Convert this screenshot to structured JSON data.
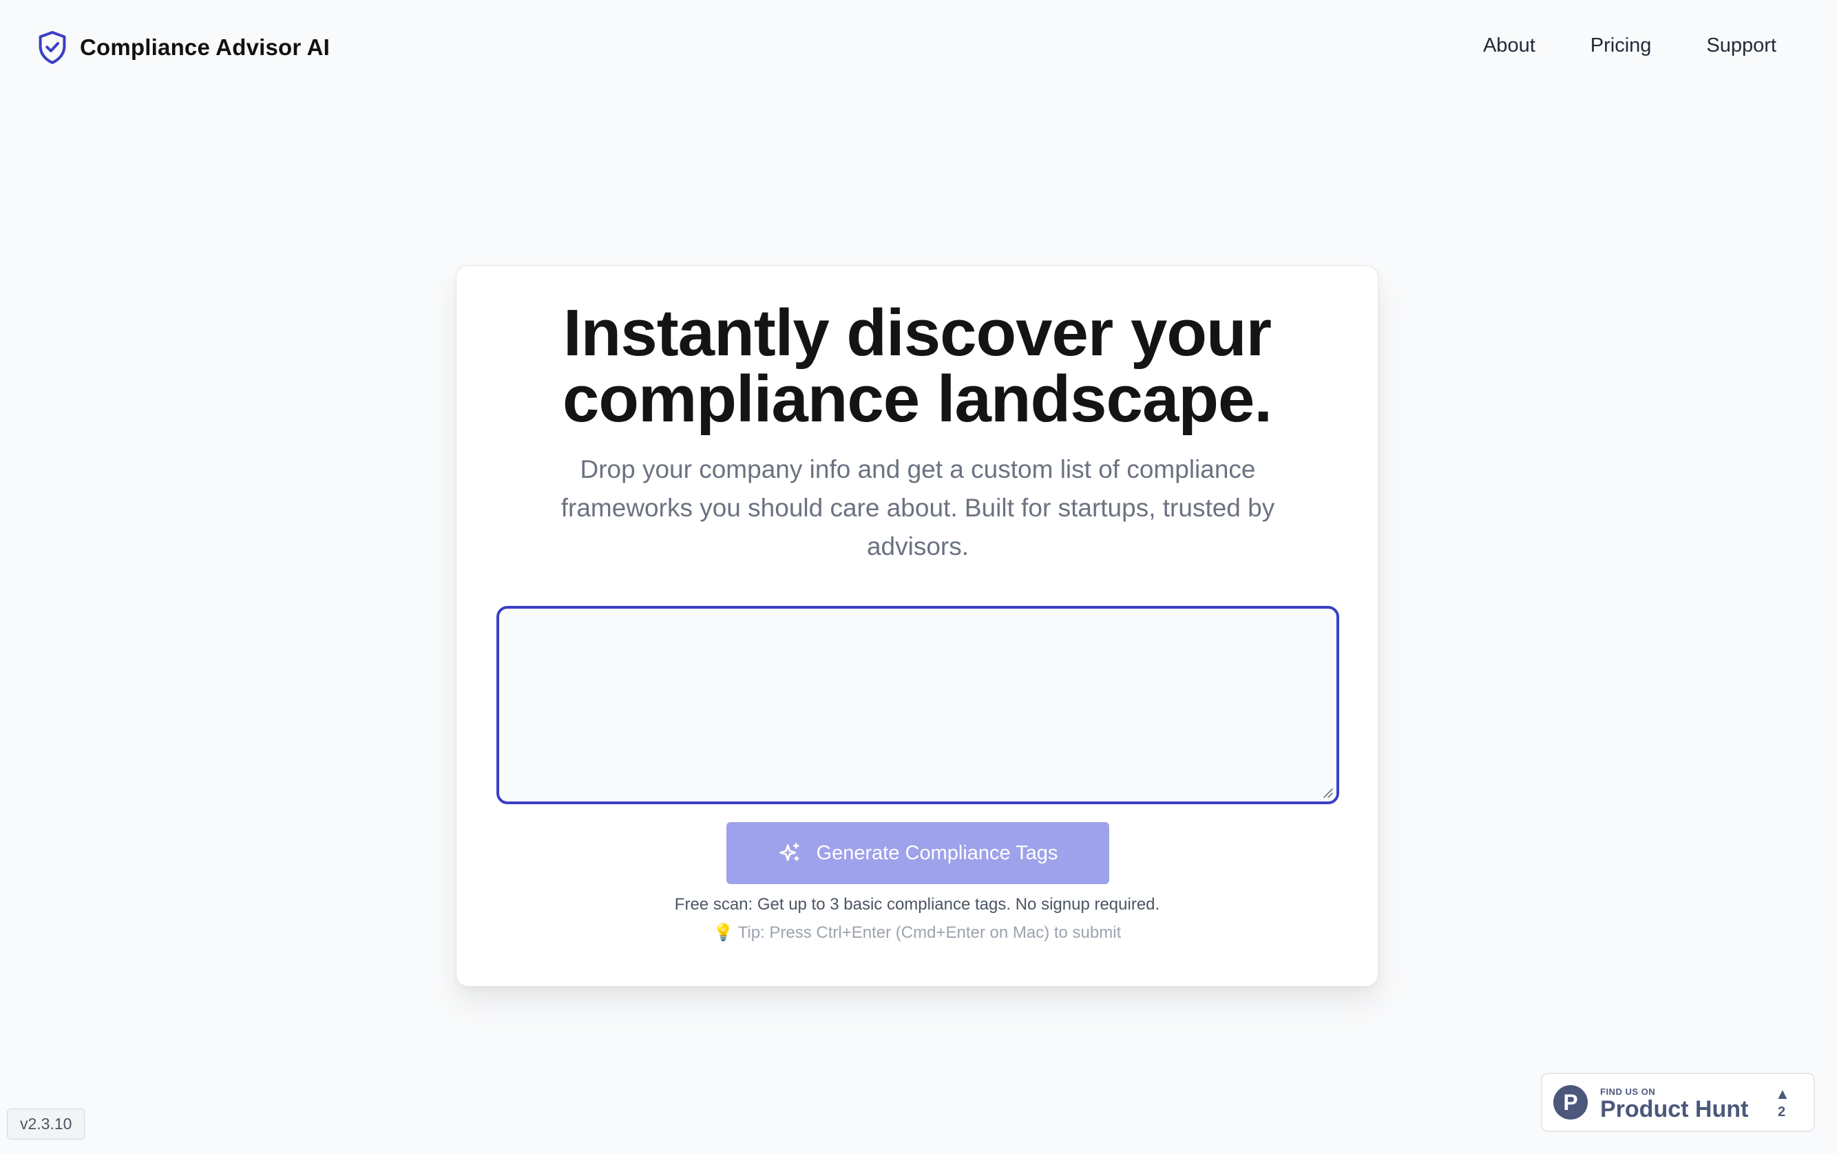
{
  "header": {
    "brand": "Compliance Advisor AI",
    "nav": [
      {
        "label": "About"
      },
      {
        "label": "Pricing"
      },
      {
        "label": "Support"
      }
    ]
  },
  "hero": {
    "title_line1": "Instantly discover your",
    "title_line2": "compliance landscape.",
    "subtitle": "Drop your company info and get a custom list of compliance frameworks you should care about. Built for startups, trusted by advisors."
  },
  "form": {
    "input_value": "",
    "input_placeholder": "",
    "button_label": "Generate Compliance Tags",
    "free_note": "Free scan: Get up to 3 basic compliance tags. No signup required.",
    "tip": "Tip: Press Ctrl+Enter (Cmd+Enter on Mac) to submit"
  },
  "footer": {
    "version": "v2.3.10"
  },
  "product_hunt": {
    "small_text": "FIND US ON",
    "big_text": "Product Hunt",
    "logo_letter": "P",
    "upvote_arrow": "▲",
    "upvote_count": "2"
  },
  "colors": {
    "accent": "#3b3fc4",
    "button_bg": "#9ea2ea",
    "page_bg": "#f9fafb",
    "product_hunt": "#4b587c"
  },
  "icons": {
    "brand": "shield-check-icon",
    "button": "sparkles-icon",
    "tip": "lightbulb-icon"
  }
}
